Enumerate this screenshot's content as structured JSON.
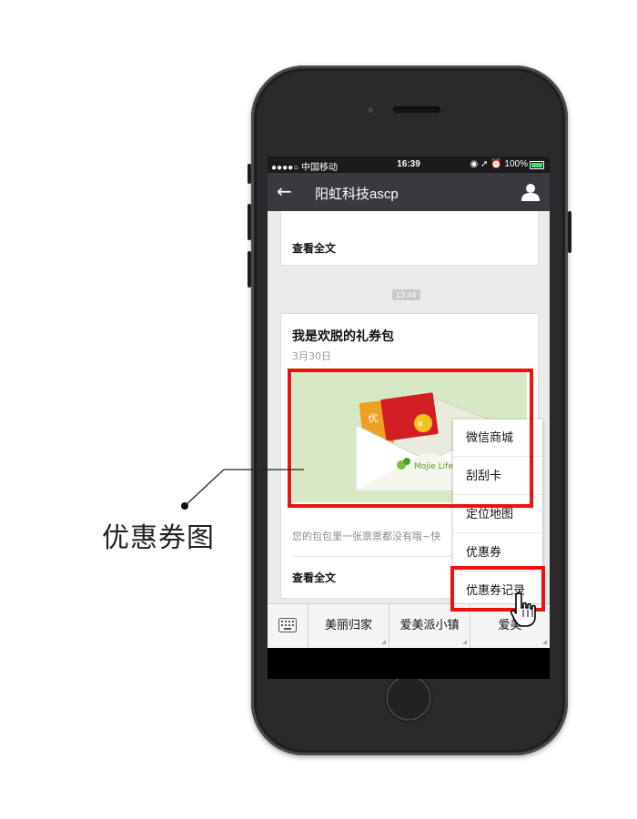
{
  "status_bar": {
    "carrier": "●●●●○ 中国移动 ",
    "time": "16:39",
    "right": "◉ ➚ ⏰ 100%"
  },
  "nav": {
    "title": "阳虹科技ascp",
    "back_icon": "back-arrow-icon",
    "user_icon": "user-icon"
  },
  "chat": {
    "prev_card": {
      "read_all": "查看全文"
    },
    "timestamp": "13:44",
    "card": {
      "title": "我是欢脱的礼券包",
      "date": "3月30日",
      "image_brand": "Mojie Life",
      "description": "您的包包里一张票票都没有哦~快",
      "read_all": "查看全文"
    }
  },
  "popup_menu": {
    "items": [
      "微信商城",
      "刮刮卡",
      "定位地图",
      "优惠券",
      "优惠券记录"
    ]
  },
  "bottom_menu": {
    "keyboard_icon": "keyboard-icon",
    "tabs": [
      "美丽归家",
      "爱美派小镇",
      "爱美"
    ]
  },
  "annotation": {
    "label": "优惠券图"
  },
  "colors": {
    "highlight": "#ee1111",
    "navbar": "#393a3f",
    "background": "#ebebeb"
  }
}
